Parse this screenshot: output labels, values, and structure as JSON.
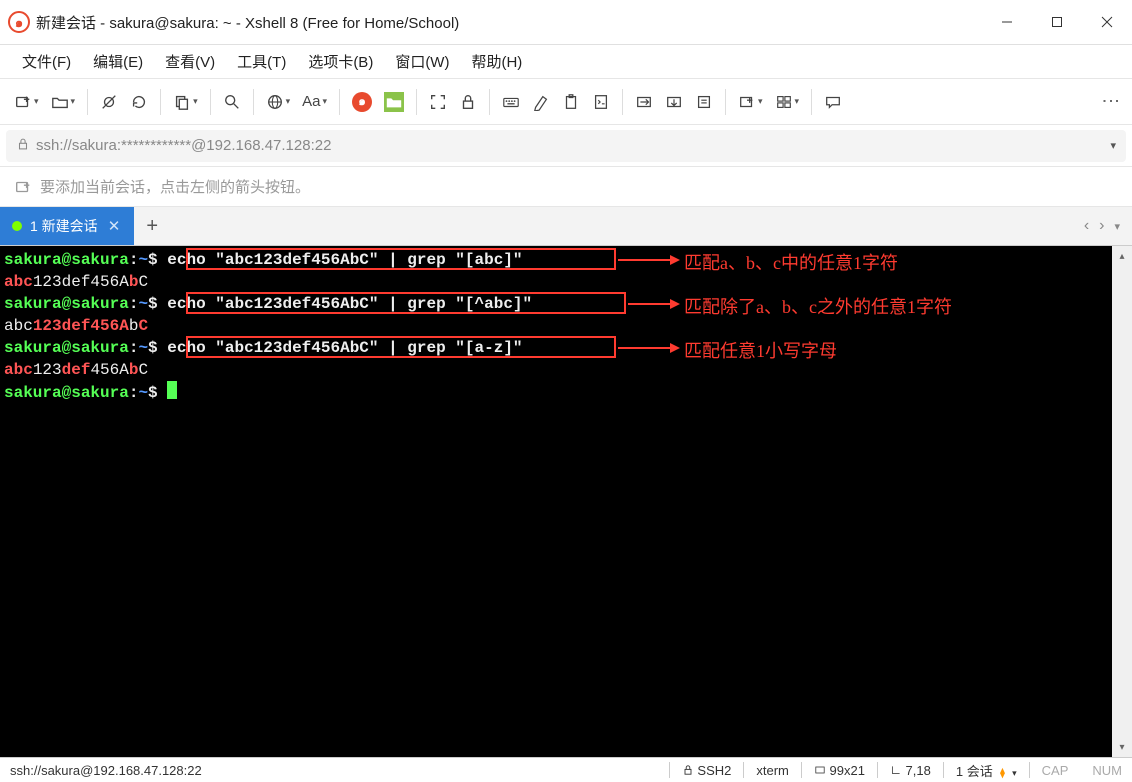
{
  "title": "新建会话 - sakura@sakura: ~ - Xshell 8 (Free for Home/School)",
  "menus": [
    "文件(F)",
    "编辑(E)",
    "查看(V)",
    "工具(T)",
    "选项卡(B)",
    "窗口(W)",
    "帮助(H)"
  ],
  "toolbar": {
    "aa_label": "Aa"
  },
  "address": "ssh://sakura:************@192.168.47.128:22",
  "hint": "要添加当前会话，点击左侧的箭头按钮。",
  "tab": {
    "label": "1 新建会话"
  },
  "annotations": [
    {
      "text": "匹配a、b、c中的任意1字符"
    },
    {
      "text": "匹配除了a、b、c之外的任意1字符"
    },
    {
      "text": "匹配任意1小写字母"
    }
  ],
  "terminal": {
    "prompt_user": "sakura@sakura",
    "prompt_sep": ":",
    "prompt_path": "~",
    "prompt_sym": "$",
    "cmd1": " echo \"abc123def456AbC\" | grep \"[abc]\"",
    "cmd2": " echo \"abc123def456AbC\" | grep \"[^abc]\"",
    "cmd3": " echo \"abc123def456AbC\" | grep \"[a-z]\"",
    "out1a": "abc",
    "out1b": "123def456A",
    "out1c": "b",
    "out1d": "C",
    "out2a": "abc",
    "out2b": "123def456A",
    "out2c": "b",
    "out2d": "C",
    "out3a": "abc",
    "out3b": "123",
    "out3c": "def",
    "out3d": "456A",
    "out3e": "b",
    "out3f": "C"
  },
  "status": {
    "left": "ssh://sakura@192.168.47.128:22",
    "ssh": "SSH2",
    "term": "xterm",
    "size": "99x21",
    "pos": "7,18",
    "sess": "1 会话",
    "cap": "CAP",
    "num": "NUM"
  }
}
